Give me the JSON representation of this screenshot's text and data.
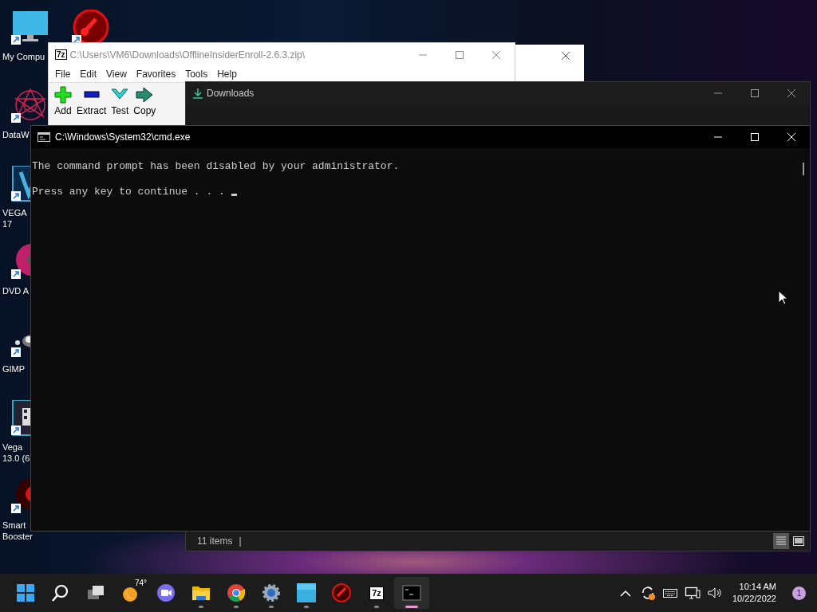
{
  "desktop_columns": [
    {
      "icons": [
        {
          "kind": "computer",
          "lines": [
            "My Compu"
          ]
        },
        {
          "kind": "mandala",
          "lines": [
            "DataW"
          ]
        },
        {
          "kind": "vegas",
          "lines": [
            "VEGA",
            "17"
          ]
        },
        {
          "kind": "disc",
          "lines": [
            "DVD A"
          ]
        },
        {
          "kind": "mascot",
          "lines": [
            "GIMP"
          ]
        },
        {
          "kind": "film",
          "lines": [
            "Vega",
            "13.0 (6"
          ]
        },
        {
          "kind": "booster",
          "lines": [
            "Smart",
            "Booster"
          ]
        }
      ]
    },
    {
      "icons": [
        {
          "kind": "gauge"
        }
      ]
    }
  ],
  "archive_window": {
    "title": "C:\\Users\\VM6\\Downloads\\OfflineInsiderEnroll-2.6.3.zip\\",
    "logo": "7z",
    "menu": [
      "File",
      "Edit",
      "View",
      "Favorites",
      "Tools",
      "Help"
    ],
    "toolbar": [
      {
        "kind": "add",
        "label": "Add"
      },
      {
        "kind": "extract",
        "label": "Extract"
      },
      {
        "kind": "test",
        "label": "Test"
      },
      {
        "kind": "copy",
        "label": "Copy"
      }
    ]
  },
  "explorer_window": {
    "title": "Downloads",
    "status": "11 items",
    "status_separator": "|",
    "views": [
      {
        "kind": "details",
        "selected": true
      },
      {
        "kind": "tiles",
        "selected": false
      }
    ]
  },
  "cmd_window": {
    "title": "C:\\Windows\\System32\\cmd.exe",
    "lines": [
      "The command prompt has been disabled by your administrator.",
      "Press any key to continue . . . "
    ],
    "cursor": true
  },
  "taskbar": {
    "apps": [
      {
        "kind": "start",
        "running": false,
        "active": false
      },
      {
        "kind": "search",
        "running": false,
        "active": false
      },
      {
        "kind": "taskview",
        "running": false,
        "active": false
      },
      {
        "kind": "weather",
        "label": "74°",
        "running": false,
        "active": false
      },
      {
        "kind": "chat",
        "running": false,
        "active": false
      },
      {
        "kind": "folder",
        "running": true,
        "active": false
      },
      {
        "kind": "browser",
        "running": true,
        "active": false
      },
      {
        "kind": "settings",
        "running": true,
        "active": false
      },
      {
        "kind": "tile",
        "running": true,
        "active": false
      },
      {
        "kind": "gauge",
        "running": false,
        "active": false
      },
      {
        "kind": "archiver",
        "label": "7z",
        "running": true,
        "active": false
      },
      {
        "kind": "terminal",
        "running": true,
        "active": true
      }
    ],
    "tray": [
      {
        "kind": "chevron"
      },
      {
        "kind": "sync"
      },
      {
        "kind": "keyboard"
      },
      {
        "kind": "network"
      },
      {
        "kind": "volume"
      }
    ],
    "time": "10:14 AM",
    "date": "10/22/2022",
    "notifications": "1"
  }
}
